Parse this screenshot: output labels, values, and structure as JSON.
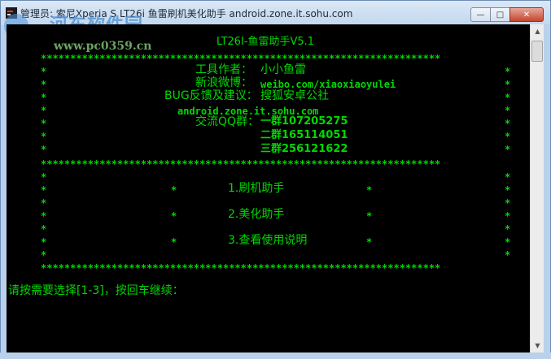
{
  "window": {
    "title": "管理员: 索尼Xperia S LT26i 鱼雷刷机美化助手 android.zone.it.sohu.com",
    "buttons": {
      "minimize": "—",
      "maximize": "□",
      "close": "✕"
    }
  },
  "watermark": {
    "logo_text": "河东软件园",
    "url": "www.pc0359.cn"
  },
  "console": {
    "header": "LT26I-鱼雷助手V5.1",
    "star_border": "********************************************************************",
    "star": "*",
    "info": {
      "author_label": "工具作者：",
      "author_value": "小小鱼雷",
      "weibo_label": "新浪微博：",
      "weibo_value": "weibo.com/xiaoxiaoyulei",
      "feedback_label": "BUG反馈及建议：",
      "feedback_value": "搜狐安卓公社",
      "site": "android.zone.it.sohu.com",
      "qq_label": "交流QQ群：",
      "qq_groups": [
        "一群107205275",
        "二群165114051",
        "三群256121622"
      ]
    },
    "menu": {
      "item1": "1.刷机助手",
      "item2": "2.美化助手",
      "item3": "3.查看使用说明"
    },
    "prompt": "请按需要选择[1-3]，按回车继续："
  },
  "scrollbar": {
    "up_arrow": "▲",
    "down_arrow": "▼"
  }
}
